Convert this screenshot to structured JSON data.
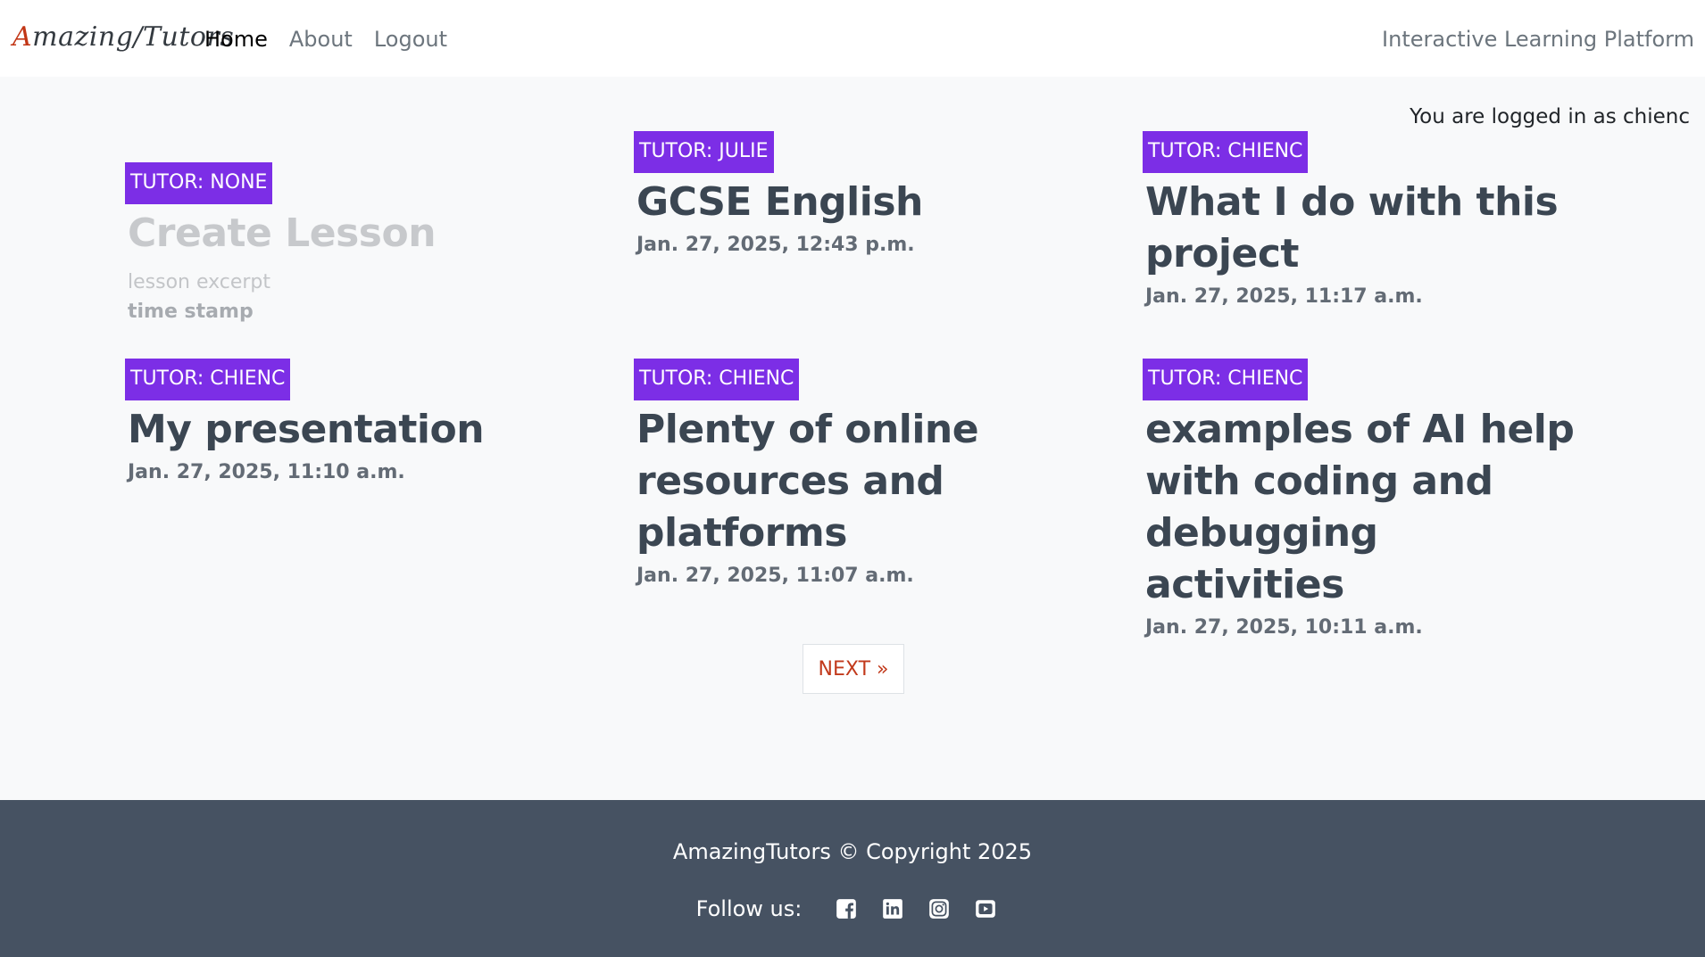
{
  "nav": {
    "brand": "Amazing/Tutors",
    "links": [
      {
        "label": "Home",
        "active": true
      },
      {
        "label": "About",
        "active": false
      },
      {
        "label": "Logout",
        "active": false
      }
    ],
    "tagline": "Interactive Learning Platform"
  },
  "session": {
    "logged_in_text": "You are logged in as chienc"
  },
  "lessons": [
    {
      "tutor": "TUTOR: NONE",
      "title": "Create Lesson",
      "excerpt": "lesson excerpt",
      "date": "time stamp",
      "placeholder": true
    },
    {
      "tutor": "TUTOR: JULIE",
      "title": "GCSE English",
      "date": "Jan. 27, 2025, 12:43 p.m."
    },
    {
      "tutor": "TUTOR: CHIENC",
      "title": "What I do with this project",
      "date": "Jan. 27, 2025, 11:17 a.m."
    },
    {
      "tutor": "TUTOR: CHIENC",
      "title": "My presentation",
      "date": "Jan. 27, 2025, 11:10 a.m."
    },
    {
      "tutor": "TUTOR: CHIENC",
      "title": "Plenty of online resources and platforms",
      "date": "Jan. 27, 2025, 11:07 a.m."
    },
    {
      "tutor": "TUTOR: CHIENC",
      "title": "examples of AI help with coding and debugging activities",
      "date": "Jan. 27, 2025, 10:11 a.m."
    }
  ],
  "pagination": {
    "next_label": "NEXT »"
  },
  "footer": {
    "copyright": "AmazingTutors © Copyright 2025",
    "follow_label": "Follow us:",
    "social_icons": [
      "facebook-icon",
      "linkedin-icon",
      "instagram-icon",
      "youtube-icon"
    ]
  },
  "colors": {
    "badge": "#7c2ee6",
    "footer_bg": "#465262",
    "next_link": "#c23a1c"
  }
}
